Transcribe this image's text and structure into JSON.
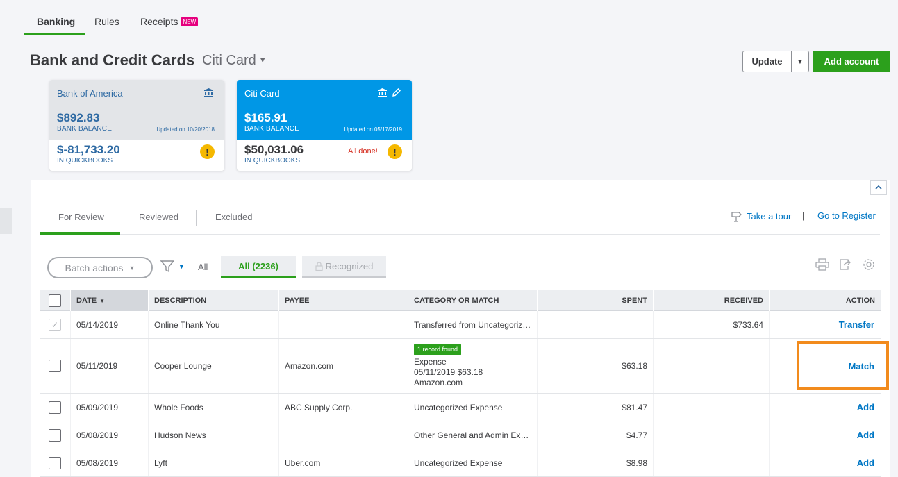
{
  "top_tabs": [
    {
      "label": "Banking"
    },
    {
      "label": "Rules"
    },
    {
      "label": "Receipts",
      "badge": "NEW"
    }
  ],
  "header": {
    "title": "Bank and Credit Cards",
    "account": "Citi Card",
    "update_label": "Update",
    "add_account_label": "Add account"
  },
  "cards": [
    {
      "name": "Bank of America",
      "bank_balance": "$892.83",
      "bank_label": "BANK BALANCE",
      "updated": "Updated on 10/20/2018",
      "qb_balance": "$-81,733.20",
      "qb_label": "IN QUICKBOOKS"
    },
    {
      "name": "Citi Card",
      "bank_balance": "$165.91",
      "bank_label": "BANK BALANCE",
      "updated": "Updated on 05/17/2019",
      "qb_balance": "$50,031.06",
      "qb_label": "IN QUICKBOOKS",
      "status": "All done!"
    }
  ],
  "review_tabs": [
    {
      "label": "For Review"
    },
    {
      "label": "Reviewed"
    },
    {
      "label": "Excluded"
    }
  ],
  "links": {
    "tour": "Take a tour",
    "separator": "|",
    "register": "Go to Register"
  },
  "toolbar": {
    "batch_actions": "Batch actions",
    "filter_all": "All",
    "chip_all": "All (2236)",
    "chip_recognized": "Recognized"
  },
  "columns": {
    "date": "DATE",
    "description": "DESCRIPTION",
    "payee": "PAYEE",
    "category": "CATEGORY OR MATCH",
    "spent": "SPENT",
    "received": "RECEIVED",
    "action": "ACTION"
  },
  "rows": [
    {
      "date": "05/14/2019",
      "description": "Online Thank You",
      "payee": "",
      "category": "Transferred from Uncategoriz…",
      "spent": "",
      "received": "$733.64",
      "action": "Transfer"
    },
    {
      "date": "05/11/2019",
      "description": "Cooper Lounge",
      "payee": "Amazon.com",
      "match_badge": "1 record found",
      "match_line1": "Expense",
      "match_line2": "05/11/2019 $63.18",
      "match_line3": "Amazon.com",
      "spent": "$63.18",
      "received": "",
      "action": "Match"
    },
    {
      "date": "05/09/2019",
      "description": "Whole Foods",
      "payee": "ABC Supply Corp.",
      "category": "Uncategorized Expense",
      "spent": "$81.47",
      "received": "",
      "action": "Add"
    },
    {
      "date": "05/08/2019",
      "description": "Hudson News",
      "payee": "",
      "category": "Other General and Admin Ex…",
      "spent": "$4.77",
      "received": "",
      "action": "Add"
    },
    {
      "date": "05/08/2019",
      "description": "Lyft",
      "payee": "Uber.com",
      "category": "Uncategorized Expense",
      "spent": "$8.98",
      "received": "",
      "action": "Add"
    }
  ],
  "colors": {
    "brand_green": "#2ca01c",
    "link_blue": "#0077c5",
    "citi_blue": "#0097e6",
    "highlight_orange": "#f28b1d",
    "warning_yellow": "#f5b800",
    "badge_pink": "#e6007e"
  },
  "icons": [
    "bank-icon",
    "pencil-icon",
    "warning-icon",
    "filter-icon",
    "lock-icon",
    "print-icon",
    "export-icon",
    "gear-icon",
    "tour-icon",
    "chevron-up-icon",
    "sort-down-icon",
    "checkmark-icon"
  ]
}
